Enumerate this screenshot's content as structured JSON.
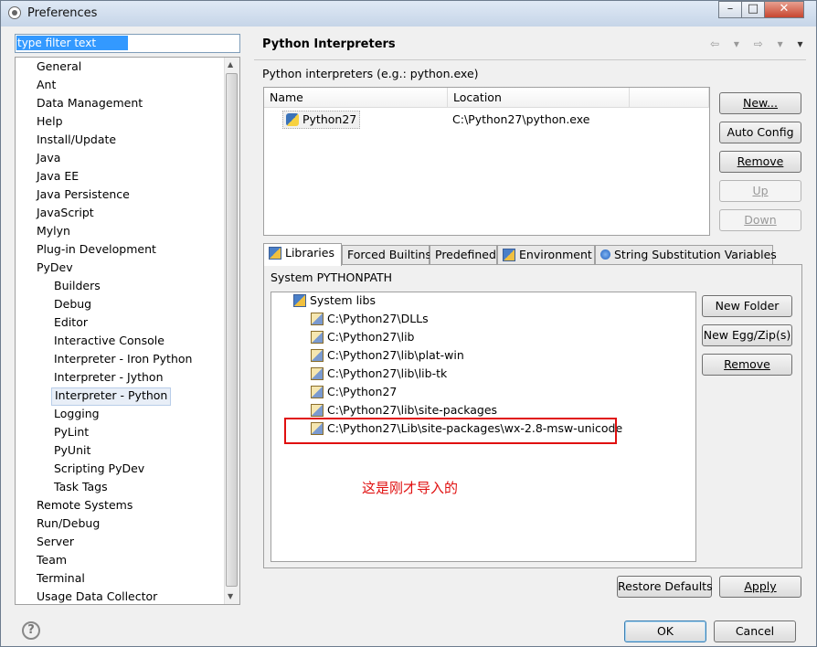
{
  "window": {
    "title": "Preferences",
    "icon": "gear-icon",
    "controls": {
      "minimize": "–",
      "maximize": "□",
      "close": "✕"
    }
  },
  "filter": {
    "value": "type filter text"
  },
  "nav_tree": [
    {
      "label": "General",
      "level": 0
    },
    {
      "label": "Ant",
      "level": 0
    },
    {
      "label": "Data Management",
      "level": 0
    },
    {
      "label": "Help",
      "level": 0
    },
    {
      "label": "Install/Update",
      "level": 0
    },
    {
      "label": "Java",
      "level": 0
    },
    {
      "label": "Java EE",
      "level": 0
    },
    {
      "label": "Java Persistence",
      "level": 0
    },
    {
      "label": "JavaScript",
      "level": 0
    },
    {
      "label": "Mylyn",
      "level": 0
    },
    {
      "label": "Plug-in Development",
      "level": 0
    },
    {
      "label": "PyDev",
      "level": 0
    },
    {
      "label": "Builders",
      "level": 1
    },
    {
      "label": "Debug",
      "level": 1
    },
    {
      "label": "Editor",
      "level": 1
    },
    {
      "label": "Interactive Console",
      "level": 1
    },
    {
      "label": "Interpreter - Iron Python",
      "level": 1
    },
    {
      "label": "Interpreter - Jython",
      "level": 1
    },
    {
      "label": "Interpreter - Python",
      "level": 1,
      "selected": true
    },
    {
      "label": "Logging",
      "level": 1
    },
    {
      "label": "PyLint",
      "level": 1
    },
    {
      "label": "PyUnit",
      "level": 1
    },
    {
      "label": "Scripting PyDev",
      "level": 1
    },
    {
      "label": "Task Tags",
      "level": 1
    },
    {
      "label": "Remote Systems",
      "level": 0
    },
    {
      "label": "Run/Debug",
      "level": 0
    },
    {
      "label": "Server",
      "level": 0
    },
    {
      "label": "Team",
      "level": 0
    },
    {
      "label": "Terminal",
      "level": 0
    },
    {
      "label": "Usage Data Collector",
      "level": 0
    }
  ],
  "page": {
    "title": "Python Interpreters",
    "nav": {
      "back": "⇦ ▾",
      "forward": "⇨ ▾",
      "menu": "▾"
    },
    "interpreters_label": "Python interpreters (e.g.: python.exe)",
    "table": {
      "columns": [
        "Name",
        "Location"
      ],
      "rows": [
        {
          "name": "Python27",
          "location": "C:\\Python27\\python.exe"
        }
      ]
    },
    "buttons": {
      "new": "New...",
      "auto_config": "Auto Config",
      "remove": "Remove",
      "up": "Up",
      "down": "Down"
    },
    "tabs": [
      {
        "label": "Libraries",
        "icon": "libraries-icon",
        "active": true
      },
      {
        "label": "Forced Builtins"
      },
      {
        "label": "Predefined"
      },
      {
        "label": "Environment",
        "icon": "environment-icon"
      },
      {
        "label": "String Substitution Variables",
        "icon": "variables-icon"
      }
    ],
    "pythonpath_label": "System PYTHONPATH",
    "libs_root": "System libs",
    "libs": [
      "C:\\Python27\\DLLs",
      "C:\\Python27\\lib",
      "C:\\Python27\\lib\\plat-win",
      "C:\\Python27\\lib\\lib-tk",
      "C:\\Python27",
      "C:\\Python27\\lib\\site-packages",
      "C:\\Python27\\Lib\\site-packages\\wx-2.8-msw-unicode"
    ],
    "lib_buttons": {
      "new_folder": "New Folder",
      "new_egg": "New Egg/Zip(s)",
      "remove": "Remove"
    },
    "annotation": "这是刚才导入的",
    "restore_defaults": "Restore Defaults",
    "apply": "Apply"
  },
  "footer": {
    "help": "?",
    "ok": "OK",
    "cancel": "Cancel"
  },
  "colors": {
    "annotation": "#e01010",
    "selection": "#3399ff"
  }
}
